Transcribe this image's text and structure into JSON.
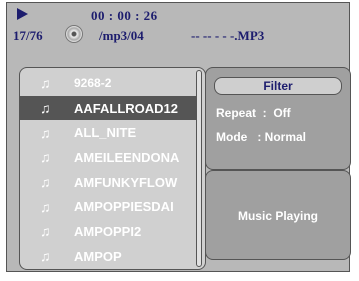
{
  "header": {
    "time": "00 : 00 : 26",
    "track": "17/76",
    "path": "/mp3/04",
    "file": "-- -- - - -.MP3"
  },
  "list": {
    "items": [
      {
        "label": "9268-2",
        "selected": false
      },
      {
        "label": "AAFALLROAD12",
        "selected": true
      },
      {
        "label": "ALL_NITE",
        "selected": false
      },
      {
        "label": "AMEILEENDONA",
        "selected": false
      },
      {
        "label": "AMFUNKYFLOW",
        "selected": false
      },
      {
        "label": "AMPOPPIESDAI",
        "selected": false
      },
      {
        "label": "AMPOPPI2",
        "selected": false
      },
      {
        "label": "AMPOP",
        "selected": false
      }
    ]
  },
  "filter": {
    "button_label": "Filter",
    "repeat": "Repeat  :  Off",
    "mode": "Mode   : Normal"
  },
  "status": {
    "text": "Music Playing"
  },
  "icons": {
    "play": "play-icon",
    "disc": "disc-icon",
    "note": "music-note-icon"
  },
  "colors": {
    "background": "#b8b8b8",
    "selected_row": "#555555",
    "text_dark": "#1d1d6e"
  }
}
